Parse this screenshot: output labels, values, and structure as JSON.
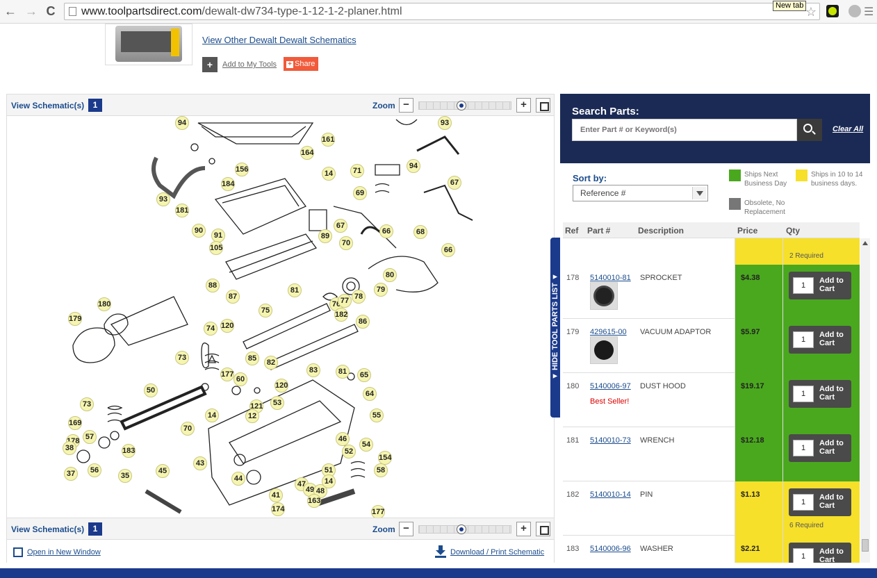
{
  "browser": {
    "url_domain": "www.toolpartsdirect.com",
    "url_path": "/dewalt-dw734-type-1-12-1-2-planer.html",
    "tooltip": "New tab",
    "back_icon": "←",
    "forward_icon": "→",
    "reload_icon": "C",
    "star_icon": "☆"
  },
  "product": {
    "view_other_label": "View Other Dewalt Dewalt Schematics",
    "add_tools_plus": "+",
    "add_tools_label": "Add to My Tools",
    "share_label": "Share"
  },
  "schematic": {
    "view_label": "View Schematic(s)",
    "view_count": "1",
    "zoom_label": "Zoom",
    "zoom_level": 0.45,
    "zoom_minus": "−",
    "zoom_plus": "+",
    "open_new_label": "Open in New Window",
    "download_label": "Download / Print Schematic",
    "callouts": [
      "94",
      "161",
      "164",
      "93",
      "156",
      "14",
      "71",
      "184",
      "67",
      "69",
      "94",
      "93",
      "181",
      "90",
      "89",
      "91",
      "105",
      "67",
      "66",
      "68",
      "70",
      "66",
      "88",
      "80",
      "87",
      "81",
      "79",
      "76",
      "77",
      "78",
      "75",
      "182",
      "86",
      "120",
      "74",
      "85",
      "82",
      "180",
      "179",
      "73",
      "177",
      "60",
      "120",
      "83",
      "81",
      "65",
      "121",
      "64",
      "53",
      "12",
      "14",
      "55",
      "50",
      "73",
      "70",
      "169",
      "57",
      "178",
      "38",
      "183",
      "46",
      "54",
      "52",
      "154",
      "56",
      "37",
      "35",
      "43",
      "44",
      "51",
      "58",
      "45",
      "41",
      "47",
      "49",
      "48",
      "14",
      "174",
      "163",
      "177"
    ]
  },
  "parts": {
    "search_title": "Search Parts:",
    "search_placeholder": "Enter Part # or Keyword(s)",
    "clear_all": "Clear All",
    "sort_label": "Sort by:",
    "sort_value": "Reference #",
    "legend": {
      "next_day": "Ships Next Business Day",
      "ten_fourteen": "Ships in 10 to 14 business days.",
      "obsolete": "Obsolete, No Replacement",
      "colors": {
        "green": "#4aa81e",
        "yellow": "#f6e02a",
        "gray": "#777777"
      }
    },
    "headers": {
      "ref": "Ref",
      "part": "Part #",
      "desc": "Description",
      "price": "Price",
      "qty": "Qty"
    },
    "side_tab_label": "▼ HIDE TOOL PARTS LIST ▼",
    "add_to_cart_line1": "Add to",
    "add_to_cart_line2": "Cart",
    "partial_row": {
      "required": "2 Required",
      "status": "yellow"
    },
    "rows": [
      {
        "ref": "178",
        "part": "5140010-81",
        "desc": "SPROCKET",
        "price": "$4.38",
        "qty": "1",
        "status": "green",
        "image": "sprocket",
        "badge": "",
        "required": ""
      },
      {
        "ref": "179",
        "part": "429615-00",
        "desc": "VACUUM ADAPTOR",
        "price": "$5.97",
        "qty": "1",
        "status": "green",
        "image": "adaptor",
        "badge": "",
        "required": ""
      },
      {
        "ref": "180",
        "part": "5140006-97",
        "desc": "DUST HOOD",
        "price": "$19.17",
        "qty": "1",
        "status": "green",
        "image": "",
        "badge": "Best Seller!",
        "required": ""
      },
      {
        "ref": "181",
        "part": "5140010-73",
        "desc": "WRENCH",
        "price": "$12.18",
        "qty": "1",
        "status": "green",
        "image": "",
        "badge": "",
        "required": ""
      },
      {
        "ref": "182",
        "part": "5140010-14",
        "desc": "PIN",
        "price": "$1.13",
        "qty": "1",
        "status": "yellow",
        "image": "",
        "badge": "",
        "required": "6 Required"
      },
      {
        "ref": "183",
        "part": "5140006-96",
        "desc": "WASHER",
        "price": "$2.21",
        "qty": "1",
        "status": "yellow",
        "image": "",
        "badge": "",
        "required": ""
      }
    ]
  }
}
